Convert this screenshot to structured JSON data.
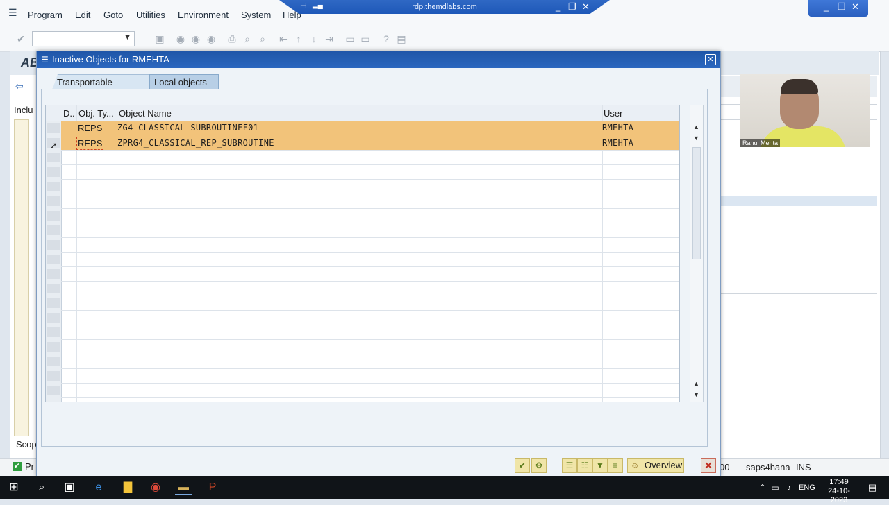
{
  "rdp": {
    "title": "rdp.themdlabs.com"
  },
  "menu": [
    "Program",
    "Edit",
    "Goto",
    "Utilities",
    "Environment",
    "System",
    "Help"
  ],
  "background": {
    "title_fragment": "AB",
    "include_label": "Inclu",
    "scope_label": "Scop",
    "status_prefix": "Pr",
    "client": "00",
    "system": "saps4hana",
    "mode": "INS"
  },
  "webcam": {
    "name": "Rahul Mehta"
  },
  "dialog": {
    "title": "Inactive Objects for RMEHTA",
    "tabs": [
      {
        "label": "Transportable Objects",
        "active": false
      },
      {
        "label": "Local objects",
        "active": true
      }
    ],
    "table": {
      "headers": {
        "d": "D..",
        "type": "Obj. Ty...",
        "name": "Object Name",
        "user": "User"
      },
      "rows": [
        {
          "type": "REPS",
          "name": "ZG4_CLASSICAL_SUBROUTINEF01",
          "user": "RMEHTA"
        },
        {
          "type": "REPS",
          "name": "ZPRG4_CLASSICAL_REP_SUBROUTINE",
          "user": "RMEHTA"
        }
      ]
    },
    "overview_label": "Overview"
  },
  "taskbar": {
    "lang": "ENG",
    "time": "17:49",
    "date": "24-10-2023"
  },
  "colors": {
    "highlight_row": "#f2c37a",
    "title_bar": "#1f56a8"
  }
}
